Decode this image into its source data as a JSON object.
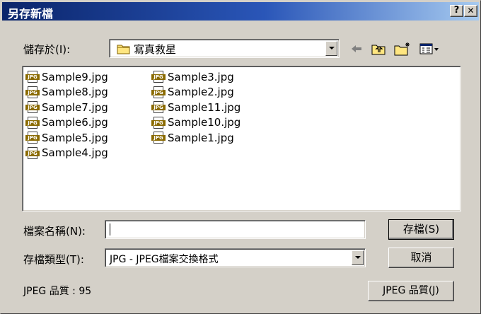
{
  "window": {
    "title": "另存新檔",
    "help_label": "?",
    "close_label": "✕"
  },
  "save_in": {
    "label": "儲存於(I):",
    "value": "寫真救星"
  },
  "toolbar": {
    "back_icon": "back-arrow-icon",
    "up_icon": "up-folder-icon",
    "new_folder_icon": "new-folder-icon",
    "view_icon": "view-menu-icon"
  },
  "files": {
    "col1": [
      "Sample9.jpg",
      "Sample8.jpg",
      "Sample7.jpg",
      "Sample6.jpg",
      "Sample5.jpg",
      "Sample4.jpg"
    ],
    "col2": [
      "Sample3.jpg",
      "Sample2.jpg",
      "Sample11.jpg",
      "Sample10.jpg",
      "Sample1.jpg"
    ],
    "icon_label": "JPG"
  },
  "filename": {
    "label": "檔案名稱(N):",
    "value": ""
  },
  "filetype": {
    "label": "存檔類型(T):",
    "value": "JPG - JPEG檔案交換格式"
  },
  "buttons": {
    "save": "存檔(S)",
    "cancel": "取消",
    "jpeg_quality": "JPEG 品質(J)"
  },
  "quality_text": "JPEG 品質 : 95",
  "colors": {
    "title_start": "#0a246a",
    "title_end": "#a6caf0",
    "face": "#d4d0c8"
  }
}
